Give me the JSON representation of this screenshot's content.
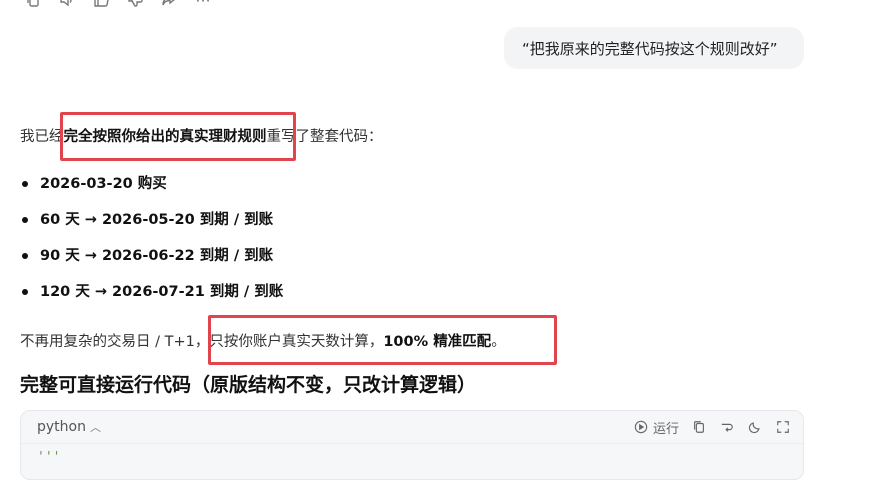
{
  "top_actions": {
    "icons": [
      "copy-icon",
      "speaker-icon",
      "thumbs-up-icon",
      "thumbs-down-icon",
      "share-icon",
      "more-icon"
    ],
    "more_label": "···"
  },
  "user_message": "“把我原来的完整代码按这个规则改好”",
  "assistant": {
    "intro_prefix": "我已经",
    "intro_bold": "完全按照你给出的真实理财规则",
    "intro_suffix": "重写了整套代码：",
    "rules": [
      "2026-03-20 购买",
      "60 天 → 2026-05-20 到期 / 到账",
      "90 天 → 2026-06-22 到期 / 到账",
      "120 天 → 2026-07-21 到期 / 到账"
    ],
    "note_prefix": "不再用复杂的交易日 / T+1，只按你账户真实天数计算，",
    "note_bold": "100% 精准匹配",
    "note_suffix": "。",
    "section_title": "完整可直接运行代码（原版结构不变，只改计算逻辑）"
  },
  "code_block": {
    "language": "python",
    "run_label": "运行",
    "first_line": "'''"
  },
  "colors": {
    "annotation": "#e0454d",
    "bubble_bg": "#f3f4f6",
    "code_bg": "#f6f7f9"
  }
}
